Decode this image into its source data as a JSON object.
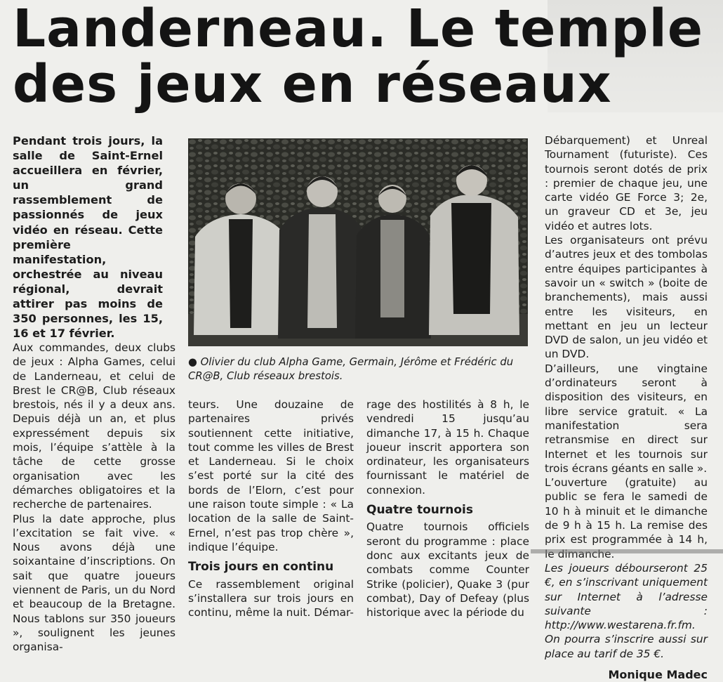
{
  "article": {
    "headline_line1": "Landerneau. Le temple",
    "headline_line2": "des jeux en réseaux",
    "lead": "Pendant trois jours, la salle de Saint-Ernel accueillera en février, un grand rassemblement de passionnés de jeux vidéo en réseau. Cette première manifestation, orchestrée au niveau régional, devrait attirer pas moins de 350 personnes, les 15, 16 et 17 février.",
    "col1_p1": "Aux commandes, deux clubs de jeux : Alpha Games, celui de Landerneau, et celui de Brest le CR@B, Club réseaux brestois, nés il y a deux ans. Depuis déjà un an, et plus expressément depuis six mois, l’équipe s’attèle à la tâche de cette grosse organisation avec les démarches obligatoires et la recherche de partenaires.",
    "col1_p2": "Plus la date approche, plus l’excitation se fait vive. « Nous avons déjà une soixantaine d’inscriptions. On sait que quatre joueurs viennent de Paris, un du Nord et beaucoup de la Bretagne. Nous tablons sur 350 joueurs », soulignent les jeunes organisa-",
    "col2_p1": "teurs. Une douzaine de partenaires privés soutiennent cette initiative, tout comme les villes de Brest et Landerneau. Si le choix s’est porté sur la cité des bords de l’Elorn, c’est pour une raison toute simple : « La location de la salle de Saint-Ernel, n’est pas trop chère », indique l’équipe.",
    "subhead1": "Trois jours en continu",
    "col2_p2": "Ce rassemblement original s’installera sur trois jours en continu, même la nuit. Démar-",
    "col3_p1": "rage des hostilités à 8 h, le vendredi 15 jusqu’au dimanche 17, à 15 h. Chaque joueur inscrit apportera son ordinateur, les organisateurs fournissant le matériel de connexion.",
    "subhead2": "Quatre tournois",
    "col3_p2": "Quatre tournois officiels seront du programme : place donc aux excitants jeux de combats comme Counter Strike (policier), Quake 3 (pur combat), Day of Defeay (plus historique avec la période du",
    "col4_p1": "Débarquement) et Unreal Tournament (futuriste). Ces tournois seront dotés de prix : premier de chaque jeu, une carte vidéo GE Force 3; 2e, un graveur CD et 3e, jeu vidéo et autres lots.",
    "col4_p2": "Les organisateurs ont prévu d’autres jeux et des tombolas entre équipes participantes à savoir un « switch » (boite de branchements), mais aussi entre les visiteurs, en mettant en jeu un lecteur DVD de salon, un jeu vidéo et un DVD.",
    "col4_p3": "D’ailleurs, une vingtaine d’ordinateurs seront à disposition des visiteurs, en libre service gratuit. « La manifestation sera retransmise en direct sur Internet et les tournois sur trois écrans géants en salle ».",
    "col4_p4": "L’ouverture (gratuite) au public se fera le samedi de 10 h à minuit et le dimanche de 9 h à 15 h. La remise des prix est programmée à 14 h, le dimanche.",
    "col4_p5": "Les joueurs débourseront 25 €, en s’inscrivant uniquement sur Internet à l’adresse suivante : http://www.westarena.fr.fm. On pourra s’inscrire aussi sur place au tarif de 35 €.",
    "byline": "Monique Madec",
    "caption": "● Olivier du club Alpha Game, Germain, Jérôme et Frédéric du CR@B, Club réseaux brestois."
  }
}
